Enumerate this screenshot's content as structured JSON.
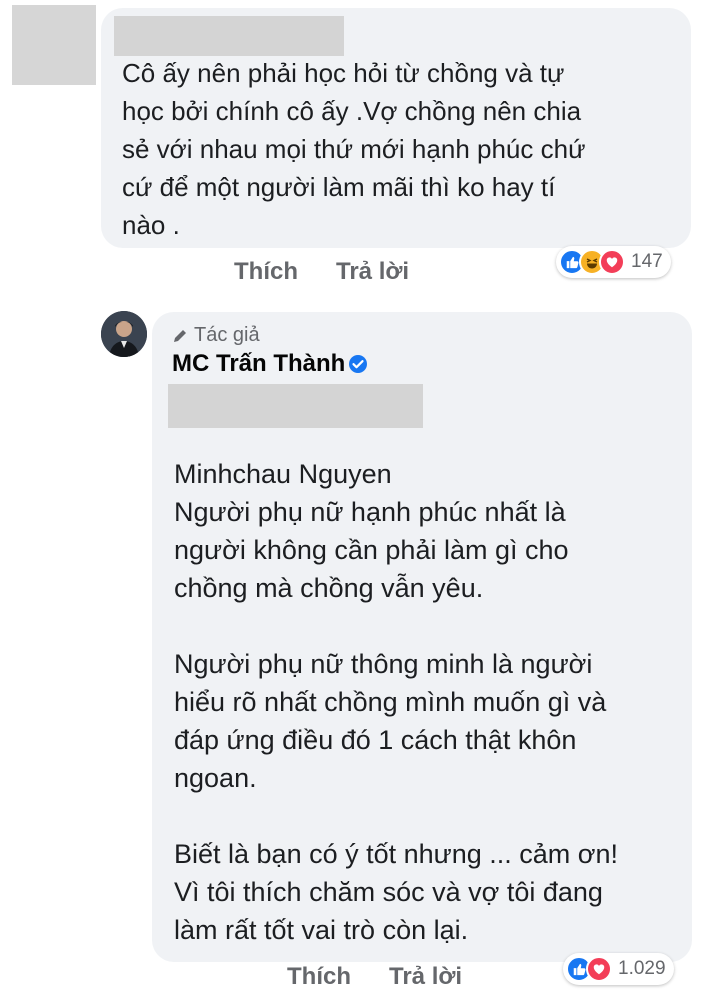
{
  "comment": {
    "text_lines": [
      "Cô ấy nên phải học hỏi từ chồng và tự",
      "học bởi chính cô ấy .Vợ chồng nên chia",
      "sẻ với nhau mọi thứ mới hạnh phúc chứ",
      "cứ để một người làm mãi thì ko hay tí",
      "nào ."
    ],
    "actions": {
      "like": "Thích",
      "reply": "Trả lời"
    },
    "reactions": {
      "icons": [
        "like-icon",
        "haha-icon",
        "love-icon"
      ],
      "count": "147"
    }
  },
  "reply": {
    "author_badge": "Tác giả",
    "author_name": "MC Trấn Thành",
    "paragraphs": [
      [
        "Minhchau Nguyen",
        "Người phụ nữ hạnh phúc nhất là",
        "người không cần phải làm gì cho",
        "chồng mà chồng vẫn yêu."
      ],
      [
        "Người phụ nữ thông minh là người",
        "hiểu rõ nhất chồng mình muốn gì và",
        "đáp ứng điều đó 1 cách thật khôn",
        "ngoan."
      ],
      [
        "Biết là bạn có ý tốt nhưng ... cảm ơn!",
        "Vì tôi thích chăm sóc và vợ tôi đang",
        "làm rất tốt vai trò còn lại."
      ]
    ],
    "actions": {
      "like": "Thích",
      "reply": "Trả lời"
    },
    "reactions": {
      "icons": [
        "like-icon",
        "love-icon"
      ],
      "count": "1.029"
    }
  },
  "colors": {
    "bubble": "#f0f2f5",
    "like_blue": "#1877f2",
    "love_red": "#f33e58",
    "haha_yellow": "#f7b125",
    "muted_text": "#65676b"
  }
}
